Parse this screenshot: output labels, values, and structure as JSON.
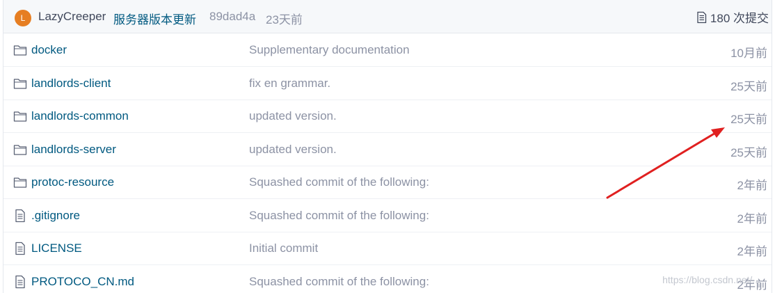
{
  "commit_header": {
    "avatar_letter": "L",
    "avatar_color": "#e67e22",
    "author": "LazyCreeper",
    "message": "服务器版本更新",
    "hash": "89dad4a",
    "time": "23天前",
    "count_label": "180 次提交",
    "count_icon": "commit-history-icon"
  },
  "files": [
    {
      "type": "folder",
      "icon": "folder-icon",
      "name": "docker",
      "message": "Supplementary documentation",
      "time": "10月前"
    },
    {
      "type": "folder",
      "icon": "folder-icon",
      "name": "landlords-client",
      "message": "fix en grammar.",
      "time": "25天前"
    },
    {
      "type": "folder",
      "icon": "folder-icon",
      "name": "landlords-common",
      "message": "updated version.",
      "time": "25天前"
    },
    {
      "type": "folder",
      "icon": "folder-icon",
      "name": "landlords-server",
      "message": "updated version.",
      "time": "25天前"
    },
    {
      "type": "folder",
      "icon": "folder-icon",
      "name": "protoc-resource",
      "message": "Squashed commit of the following:",
      "time": "2年前"
    },
    {
      "type": "file",
      "icon": "file-icon",
      "name": ".gitignore",
      "message": "Squashed commit of the following:",
      "time": "2年前"
    },
    {
      "type": "file",
      "icon": "file-icon",
      "name": "LICENSE",
      "message": "Initial commit",
      "time": "2年前"
    },
    {
      "type": "file",
      "icon": "file-icon",
      "name": "PROTOCO_CN.md",
      "message": "Squashed commit of the following:",
      "time": "2年前"
    }
  ],
  "watermark": "https://blog.csdn.net/...",
  "annotation": {
    "type": "red-arrow",
    "color": "#e02020",
    "points_to": "landlords-common time"
  },
  "colors": {
    "link": "#005980",
    "muted": "#8c92a4",
    "text": "#40485b",
    "header_bg": "#f6f8fa"
  }
}
